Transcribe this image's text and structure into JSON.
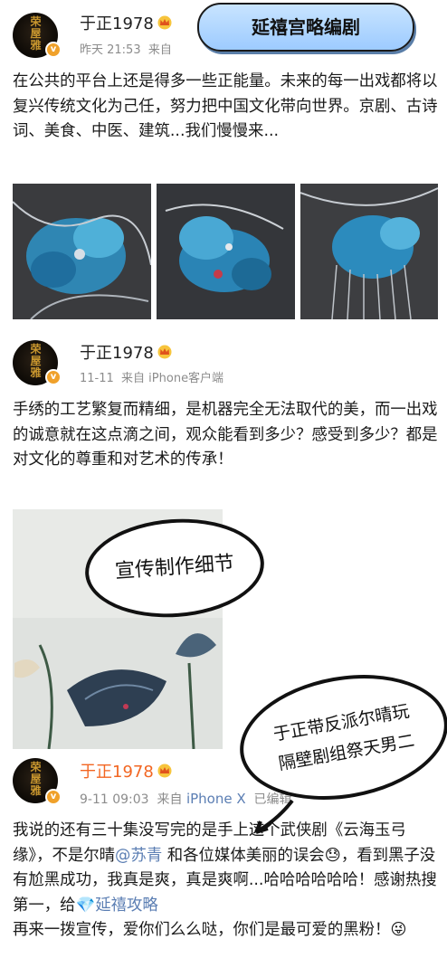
{
  "header_banner": {
    "text": "延禧宫略编剧"
  },
  "post1": {
    "avatar_text": "荣\n屋\n雅",
    "username": "于正1978",
    "time": "昨天 21:53",
    "source_prefix": "来自",
    "body": "在公共的平台上还是得多一些正能量。未来的每一出戏都将以复兴传统文化为己任，努力把中国文化带向世界。京剧、古诗词、美食、中医、建筑...我们慢慢来...",
    "images": [
      "hairpin-1",
      "hairpin-2",
      "hairpin-3"
    ]
  },
  "post2": {
    "avatar_text": "荣\n屋\n雅",
    "username": "于正1978",
    "time": "11-11",
    "source": "来自 iPhone客户端",
    "body": "手绣的工艺繁复而精细，是机器完全无法取代的美，而一出戏的诚意就在这点滴之间，观众能看到多少？感受到多少？都是对文化的尊重和对艺术的传承！",
    "image_annotation": "宣传制作细节"
  },
  "post3": {
    "avatar_text": "荣\n屋\n雅",
    "username": "于正1978",
    "time": "9-11 09:03",
    "source_prefix": "来自",
    "source_device": "iPhone X",
    "edited": "已编辑",
    "body_part1": "我说的还有三十集没写完的是手上这个武侠剧《云海玉弓缘》，不是尔晴",
    "mention": "@苏青",
    "body_part2": " 和各位媒体美丽的误会",
    "emoji1": "😓",
    "body_part3": "，看到黑子没有尬黑成功，我真是爽，真是爽啊...哈哈哈哈哈哈！感谢热搜第一，给",
    "topic_icon": "💎",
    "topic": "延禧攻略",
    "body_part4": "再来一拨宣传，爱你们么么哒，你们是最可爱的黑粉！",
    "emoji2": "😜"
  },
  "annotation_bubble2": {
    "line1": "于正带反派尔晴玩",
    "line2": "隔壁剧组祭天男二"
  },
  "colors": {
    "link": "#5b7eb3",
    "username_highlight": "#f26622",
    "meta": "#8c8c8c",
    "banner": "#9dcbff"
  }
}
